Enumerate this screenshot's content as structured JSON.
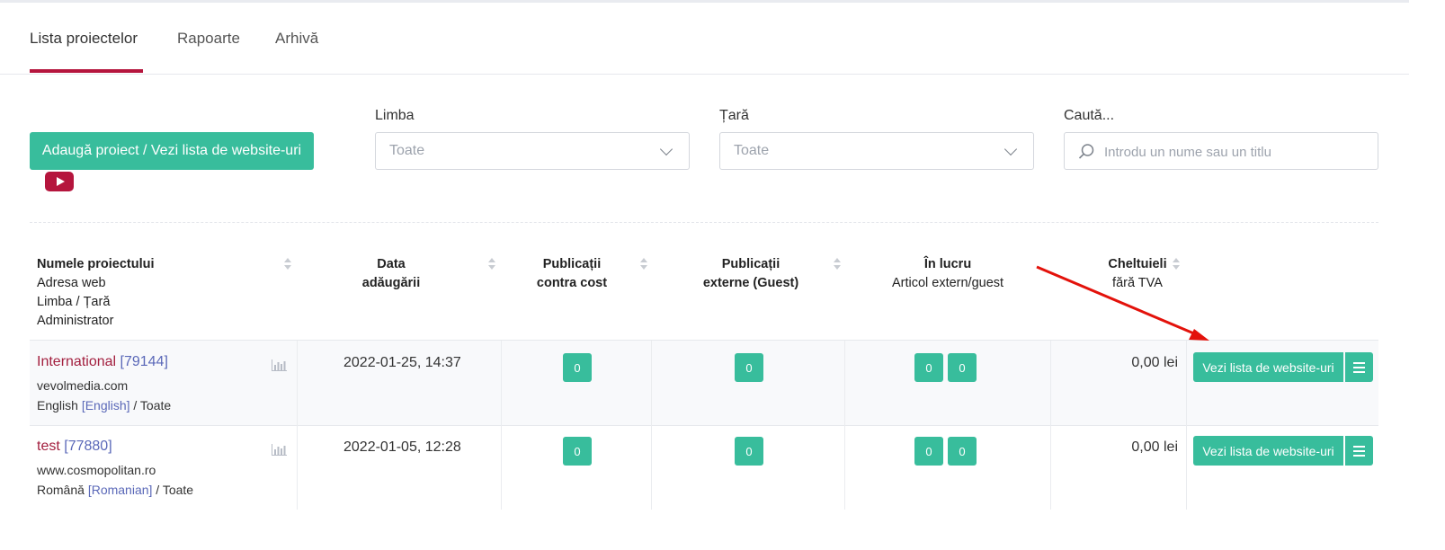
{
  "tabs": [
    {
      "label": "Lista proiectelor",
      "active": true
    },
    {
      "label": "Rapoarte",
      "active": false
    },
    {
      "label": "Arhivă",
      "active": false
    }
  ],
  "toolbar": {
    "add_button_label": "Adaugă proiect / Vezi lista de website-uri",
    "youtube_icon": "youtube-play-icon"
  },
  "filters": {
    "language": {
      "label": "Limba",
      "value": "Toate"
    },
    "country": {
      "label": "Țară",
      "value": "Toate"
    },
    "search": {
      "label": "Caută...",
      "placeholder": "Introdu un nume sau un titlu"
    }
  },
  "table": {
    "headers": {
      "project": [
        "Numele proiectului",
        "Adresa web",
        "Limba / Țară",
        "Administrator"
      ],
      "date": [
        "Data",
        "adăugării"
      ],
      "paid": [
        "Publicații",
        "contra cost"
      ],
      "guest": [
        "Publicații",
        "externe (Guest)"
      ],
      "inwork": [
        "În lucru",
        "Articol extern/guest"
      ],
      "costs": [
        "Cheltuieli",
        "fără TVA"
      ]
    },
    "rows": [
      {
        "name": "International",
        "id": "[79144]",
        "url": "vevolmedia.com",
        "lang": "English",
        "lang_bracket": "[English]",
        "country": "/ Toate",
        "date": "2022-01-25, 14:37",
        "paid": "0",
        "guest": "0",
        "inwork_a": "0",
        "inwork_b": "0",
        "amount": "0,00 lei",
        "action_label": "Vezi lista de website-uri"
      },
      {
        "name": "test",
        "id": "[77880]",
        "url": "www.cosmopolitan.ro",
        "lang": "Română",
        "lang_bracket": "[Romanian]",
        "country": "/ Toate",
        "date": "2022-01-05, 12:28",
        "paid": "0",
        "guest": "0",
        "inwork_a": "0",
        "inwork_b": "0",
        "amount": "0,00 lei",
        "action_label": "Vezi lista de website-uri"
      }
    ]
  },
  "colors": {
    "accent": "#38bd9c",
    "brand": "#b5153d",
    "link": "#5a68b8",
    "annotation_arrow": "#e3120b"
  }
}
